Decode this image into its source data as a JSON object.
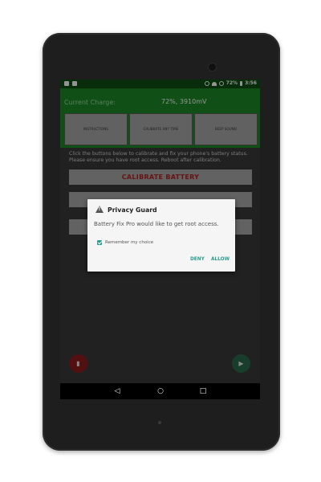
{
  "status_bar": {
    "battery_percent": "72%",
    "time": "3:56",
    "left_icons": [
      "storage-icon",
      "android-icon"
    ],
    "right_icons": [
      "block-icon",
      "wifi-icon",
      "sync-icon",
      "battery-icon"
    ]
  },
  "app": {
    "charge_label": "Current Charge:",
    "charge_value": "72%, 3910mV",
    "buttons": [
      "INSTRUCTIONS",
      "CALIBRATE ANY TIME",
      "BEEP SOUND"
    ],
    "info_text": "Click the buttons below to calibrate and fix your phone's battery status. Please ensure you have root access. Reboot after calibration.",
    "calibrate_label": "CALIBRATE BATTERY",
    "fab_left_icon": "trash-icon",
    "fab_right_icon": "play-icon"
  },
  "dialog": {
    "title": "Privacy Guard",
    "message": "Battery Fix Pro would like to get root access.",
    "checkbox_label": "Remember my choice",
    "checkbox_checked": true,
    "deny_label": "DENY",
    "allow_label": "ALLOW"
  },
  "nav_bar": {
    "icons": [
      "back-icon",
      "home-icon",
      "recents-icon"
    ]
  },
  "colors": {
    "status_bar": "#0f4f14",
    "header": "#1c8a27",
    "calibrate_text": "#b22222",
    "dialog_accent": "#2a9d8f"
  }
}
